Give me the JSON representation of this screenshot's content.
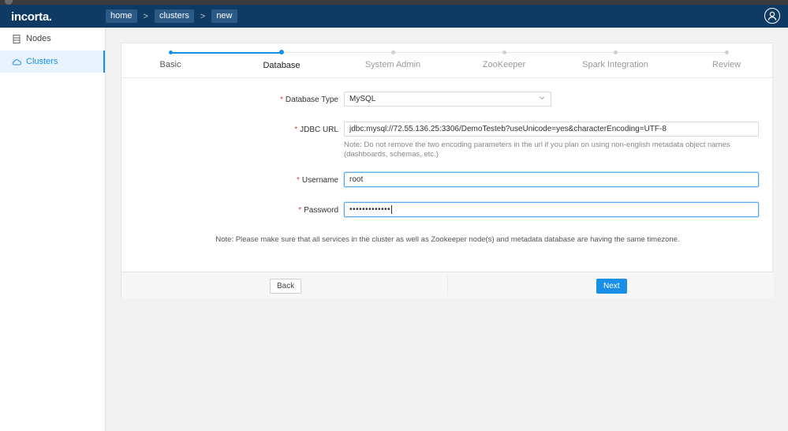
{
  "header": {
    "logo": "incorta.",
    "breadcrumbs": [
      "home",
      "clusters",
      "new"
    ],
    "breadcrumb_separator": ">"
  },
  "sidebar": {
    "items": [
      {
        "label": "Nodes",
        "icon": "list-icon",
        "active": false
      },
      {
        "label": "Clusters",
        "icon": "cloud-icon",
        "active": true
      }
    ]
  },
  "stepper": {
    "steps": [
      "Basic",
      "Database",
      "System Admin",
      "ZooKeeper",
      "Spark Integration",
      "Review"
    ],
    "current_index": 1
  },
  "form": {
    "database_type": {
      "label": "Database Type",
      "value": "MySQL"
    },
    "jdbc_url": {
      "label": "JDBC URL",
      "value": "jdbc:mysql://72.55.136.25:3306/DemoTesteb?useUnicode=yes&characterEncoding=UTF-8",
      "note": "Note: Do not remove the two encoding parameters in the url if you plan on using non-english metadata object names (dashboards, schemas, etc.)"
    },
    "username": {
      "label": "Username",
      "value": "root"
    },
    "password": {
      "label": "Password",
      "value": "•••••••••••••"
    },
    "required_mark": "*",
    "timezone_note": "Note: Please make sure that all services in the cluster as well as Zookeeper node(s) and metadata database are having the same timezone."
  },
  "footer": {
    "back_label": "Back",
    "next_label": "Next"
  },
  "colors": {
    "header_bg": "#0e3a63",
    "accent": "#1a8fe8",
    "required": "#e23c3c"
  }
}
